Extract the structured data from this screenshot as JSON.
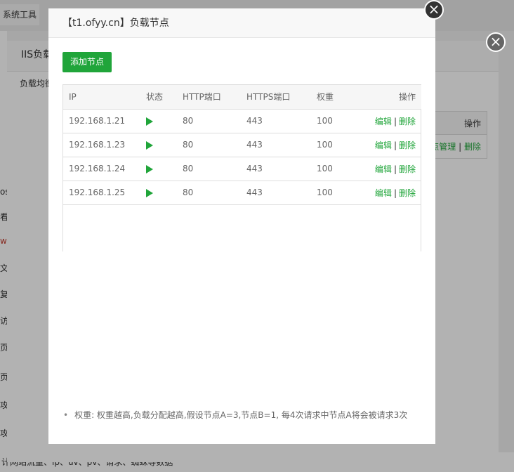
{
  "background": {
    "top_tabs": [
      "系统工具"
    ],
    "sidebar_fragments": [
      "os",
      "看",
      "ws",
      "文",
      "复",
      "访",
      "页",
      "页",
      "攻",
      "攻"
    ],
    "bottom_text": "计网站流量、ip、uv、pv、请求、蜘蛛等数据"
  },
  "back_dialog": {
    "title": "IIS负载",
    "subtitle": "负载均衡",
    "table_header_action": "操作",
    "row_action_node_manage": "点管理",
    "row_action_delete": "删除"
  },
  "dialog": {
    "title": "【t1.ofyy.cn】负载节点",
    "add_button": "添加节点",
    "columns": {
      "ip": "IP",
      "status": "状态",
      "http_port": "HTTP端口",
      "https_port": "HTTPS端口",
      "weight": "权重",
      "action": "操作"
    },
    "rows": [
      {
        "ip": "192.168.1.21",
        "http": "80",
        "https": "443",
        "weight": "100",
        "edit": "编辑",
        "delete": "删除"
      },
      {
        "ip": "192.168.1.23",
        "http": "80",
        "https": "443",
        "weight": "100",
        "edit": "编辑",
        "delete": "删除"
      },
      {
        "ip": "192.168.1.24",
        "http": "80",
        "https": "443",
        "weight": "100",
        "edit": "编辑",
        "delete": "删除"
      },
      {
        "ip": "192.168.1.25",
        "http": "80",
        "https": "443",
        "weight": "100",
        "edit": "编辑",
        "delete": "删除"
      }
    ],
    "tip": "权重: 权重越高,负载分配越高,假设节点A=3,节点B=1, 每4次请求中节点A将会被请求3次"
  },
  "colors": {
    "accent": "#20a53a",
    "close_button": "#333333"
  },
  "icons": {
    "close": "close-icon",
    "status_running": "play-icon"
  }
}
